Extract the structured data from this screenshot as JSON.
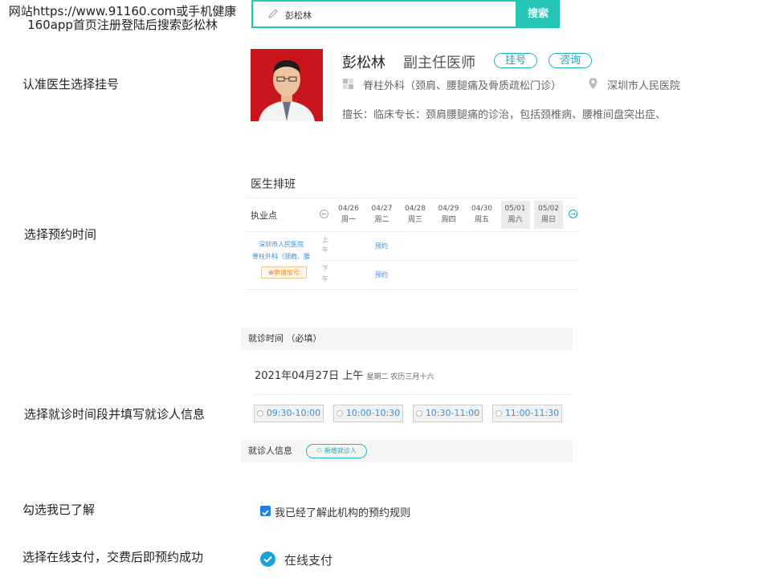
{
  "steps": [
    "网站https://www.91160.com或手机健康160app首页注册登陆后搜索彭松林",
    "认准医生选择挂号",
    "选择预约时间",
    "选择就诊时间段并填写就诊人信息",
    "勾选我已了解",
    "选择在线支付，交费后即预约成功"
  ],
  "search": {
    "value": "彭松林",
    "button": "搜索"
  },
  "doctor": {
    "name": "彭松林",
    "title": "副主任医师",
    "register": "挂号",
    "consult": "咨询",
    "department": "脊柱外科（颈肩、腰腿痛及骨质疏松门诊）",
    "hospital": "深圳市人民医院",
    "expertise": "擅长：临床专长：颈肩腰腿痛的诊治，包括颈椎病、腰椎间盘突出症、"
  },
  "schedule": {
    "title": "医生排班",
    "site_label": "执业点",
    "days": [
      {
        "date": "04/26",
        "weekday": "周一",
        "weekend": false
      },
      {
        "date": "04/27",
        "weekday": "周二",
        "weekend": false
      },
      {
        "date": "04/28",
        "weekday": "周三",
        "weekend": false
      },
      {
        "date": "04/29",
        "weekday": "周四",
        "weekend": false
      },
      {
        "date": "04/30",
        "weekday": "周五",
        "weekend": false
      },
      {
        "date": "05/01",
        "weekday": "周六",
        "weekend": true
      },
      {
        "date": "05/02",
        "weekday": "周日",
        "weekend": true
      }
    ],
    "hospital_link": "深圳市人民医院",
    "dept_link": "脊柱外科（颈肩、腰",
    "add_number": "申请加号",
    "am": "上午",
    "pm": "下午",
    "book": "预约"
  },
  "visit": {
    "header": "就诊时间 （必填）",
    "date": "2021年04月27日 上午",
    "date_sub": "星期二 农历三月十六",
    "slots": [
      "09:30-10:00",
      "10:00-10:30",
      "10:30-11:00",
      "11:00-11:30"
    ]
  },
  "patient": {
    "label": "就诊人信息",
    "add": "新增就诊人"
  },
  "agree": "我已经了解此机构的预约规则",
  "payment": "在线支付",
  "colors": {
    "accent": "#26c6b8",
    "link": "#3a8fd6",
    "pay": "#1aa3d6"
  }
}
